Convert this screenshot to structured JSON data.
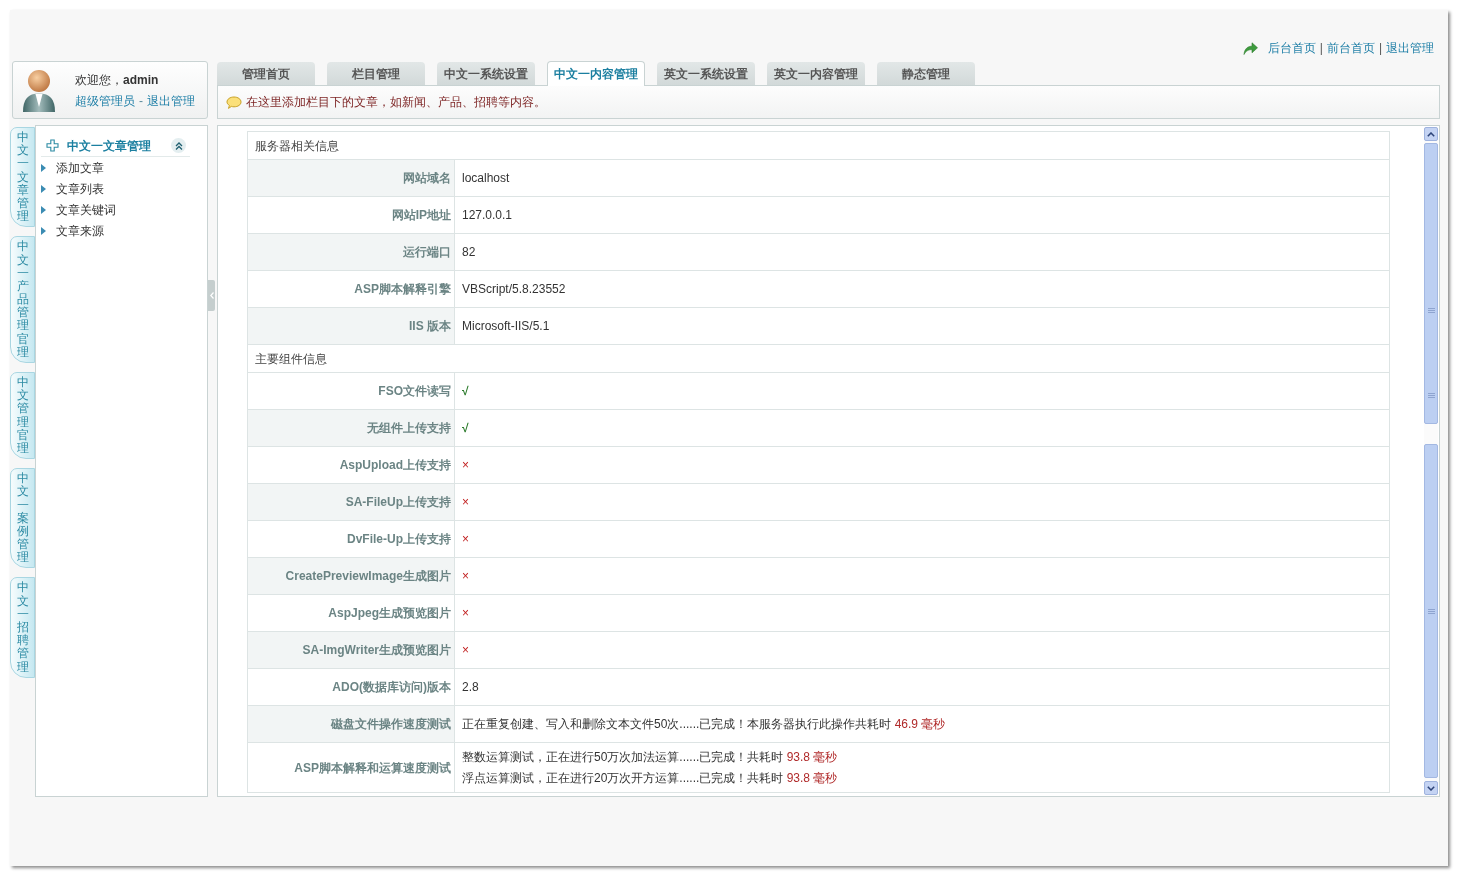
{
  "header_links": [
    {
      "kind": "link",
      "label": "后台首页"
    },
    {
      "kind": "separator",
      "label": "|"
    },
    {
      "kind": "link",
      "label": "前台首页"
    },
    {
      "kind": "separator",
      "label": "|"
    },
    {
      "kind": "link",
      "label": "退出管理"
    }
  ],
  "user": {
    "greeting": "欢迎您，**admin**",
    "links": [
      {
        "kind": "link",
        "label": "超级管理员"
      },
      {
        "kind": "separator",
        "label": "-"
      },
      {
        "kind": "link",
        "label": "退出管理"
      }
    ]
  },
  "tabs": [
    {
      "label": "管理首页",
      "selected": false
    },
    {
      "label": "栏目管理",
      "selected": false
    },
    {
      "label": "中文一系统设置",
      "selected": false
    },
    {
      "label": "中文一内容管理",
      "selected": true
    },
    {
      "label": "英文一系统设置",
      "selected": false
    },
    {
      "label": "英文一内容管理",
      "selected": false
    },
    {
      "label": "静态管理",
      "selected": false
    }
  ],
  "notice": {
    "text": "在这里添加栏目下的文章，如新闻、产品、招聘等内容。"
  },
  "side_tabs": [
    {
      "label": "中文一文章管理"
    },
    {
      "label": "中文一产品管理官理"
    },
    {
      "label": "中文管理官理"
    },
    {
      "label": "中文一案例管理"
    },
    {
      "label": "中文一招聘管理"
    }
  ],
  "menu": {
    "title": "中文一文章管理",
    "expanded": true,
    "items": [
      {
        "label": "添加文章"
      },
      {
        "label": "文章列表"
      },
      {
        "label": "文章关键词"
      },
      {
        "label": "文章来源"
      }
    ]
  },
  "table": {
    "sections": [
      {
        "title": "服务器相关信息",
        "rows": [
          {
            "label": "网站域名",
            "kind": "text",
            "value": "localhost"
          },
          {
            "label": "网站IP地址",
            "kind": "text",
            "value": "127.0.0.1"
          },
          {
            "label": "运行端口",
            "kind": "text",
            "value": "82"
          },
          {
            "label": "ASP脚本解释引擎",
            "kind": "text",
            "value": "VBScript/5.8.23552"
          },
          {
            "label": "IIS 版本",
            "kind": "text",
            "value": "Microsoft-IIS/5.1"
          }
        ]
      },
      {
        "title": "主要组件信息",
        "rows": [
          {
            "label": "FSO文件读写",
            "kind": "pass",
            "value": "√"
          },
          {
            "label": "无组件上传支持",
            "kind": "pass",
            "value": "√"
          },
          {
            "label": "AspUpload上传支持",
            "kind": "fail",
            "value": "×"
          },
          {
            "label": "SA-FileUp上传支持",
            "kind": "fail",
            "value": "×"
          },
          {
            "label": "DvFile-Up上传支持",
            "kind": "fail",
            "value": "×"
          },
          {
            "label": "CreatePreviewImage生成图片",
            "kind": "fail",
            "value": "×"
          },
          {
            "label": "AspJpeg生成预览图片",
            "kind": "fail",
            "value": "×"
          },
          {
            "label": "SA-ImgWriter生成预览图片",
            "kind": "fail",
            "value": "×"
          },
          {
            "label": "ADO(数据库访问)版本",
            "kind": "text",
            "value": "2.8"
          },
          {
            "label": "磁盘文件操作速度测试",
            "kind": "timing",
            "lines": [
              {
                "text": "正在重复创建、写入和删除文本文件50次......已完成！本服务器执行此操作共耗时",
                "time": "46.9 毫秒"
              }
            ]
          },
          {
            "label": "ASP脚本解释和运算速度测试",
            "kind": "timing",
            "lines": [
              {
                "text": "整数运算测试，正在进行50万次加法运算......已完成！共耗时",
                "time": "93.8 毫秒"
              },
              {
                "text": "浮点运算测试，正在进行20万次开方运算......已完成！共耗时",
                "time": "93.8 毫秒"
              }
            ]
          }
        ]
      }
    ]
  }
}
